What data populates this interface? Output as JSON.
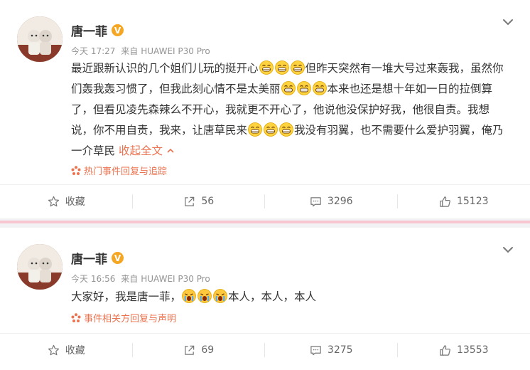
{
  "posts": [
    {
      "user": "唐一菲",
      "time": "今天 17:27",
      "source_prefix": "来自",
      "device": "HUAWEI P30 Pro",
      "text_1": "最近跟新认识的几个姐们儿玩的挺开心",
      "text_2": "但昨天突然有一堆大号过来轰我，虽然你们轰我轰习惯了，但我此刻心情不是太美丽",
      "text_3": "本来也还是想十年如一日的拉倒算了，但看见凌先森辣么不开心，我就更不开心了，他说他没保护好我，他很自责。我想说，你不用自责，我来，让唐草民来",
      "text_4": "我没有羽翼，也不需要什么爱护羽翼，俺乃一介草民",
      "expand_label": "收起全文",
      "tag": "热门事件回复与追踪",
      "actions": {
        "favorite": "收藏",
        "repost": "56",
        "comment": "3296",
        "like": "15123"
      }
    },
    {
      "user": "唐一菲",
      "time": "今天 16:56",
      "source_prefix": "来自",
      "device": "HUAWEI P30 Pro",
      "text_1": "大家好，我是唐一菲，",
      "text_2": "本人，本人，本人",
      "tag": "事件相关方回复与声明",
      "actions": {
        "favorite": "收藏",
        "repost": "69",
        "comment": "3275",
        "like": "13553"
      }
    }
  ],
  "colors": {
    "accent": "#eb7350",
    "verified": "#f5a623",
    "separator": "#f7c6d0"
  }
}
